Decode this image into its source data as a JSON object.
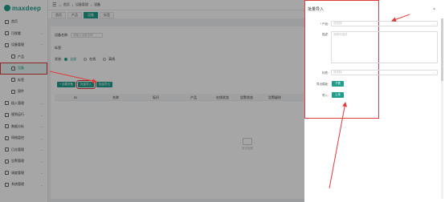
{
  "brand": {
    "name": "maxdeep"
  },
  "header": {
    "breadcrumb": [
      "首页",
      "设备管理",
      "设备"
    ]
  },
  "tabs": [
    {
      "label": "首页",
      "active": false
    },
    {
      "label": "产品",
      "active": false
    },
    {
      "label": "设备",
      "active": true
    },
    {
      "label": "标签",
      "active": false
    }
  ],
  "sidebar": {
    "items": [
      {
        "label": "首页",
        "sub": false,
        "active": false
      },
      {
        "label": "可视看",
        "sub": false,
        "active": false,
        "chev": "⌄"
      },
      {
        "label": "设备管理",
        "sub": false,
        "active": false,
        "chev": "⌃"
      },
      {
        "label": "产品",
        "sub": true,
        "active": false
      },
      {
        "label": "设备",
        "sub": true,
        "active": true
      },
      {
        "label": "标签",
        "sub": true,
        "active": false
      },
      {
        "label": "固件",
        "sub": true,
        "active": false
      },
      {
        "label": "插入管理",
        "sub": false,
        "active": false,
        "chev": "⌄"
      },
      {
        "label": "规则运行",
        "sub": false,
        "active": false,
        "chev": "⌄"
      },
      {
        "label": "数据分析",
        "sub": false,
        "active": false,
        "chev": "⌄"
      },
      {
        "label": "网络监控",
        "sub": false,
        "active": false,
        "chev": "⌄"
      },
      {
        "label": "日志管理",
        "sub": false,
        "active": false,
        "chev": "⌄"
      },
      {
        "label": "告警管理",
        "sub": false,
        "active": false,
        "chev": "⌄"
      },
      {
        "label": "调度管理",
        "sub": false,
        "active": false,
        "chev": "⌄"
      },
      {
        "label": "系统管理",
        "sub": false,
        "active": false,
        "chev": "⌄"
      }
    ]
  },
  "filter": {
    "name_label": "设备名称:",
    "name_placeholder": "请输入设备名称",
    "tag_label": "标签:",
    "status_label": "状态:",
    "status_options": [
      "全部",
      "在线",
      "离线"
    ],
    "status_selected": 0
  },
  "toolbar": {
    "buttons": [
      "+ 创建设备",
      "批量导入",
      "批量导出"
    ]
  },
  "table": {
    "columns": [
      "ID",
      "名称",
      "标识",
      "产品",
      "在线状态",
      "告警状态",
      "告警级别"
    ]
  },
  "empty": {
    "text": "暂无数据"
  },
  "dialog": {
    "title": "批量导入",
    "close": "×",
    "product_label": "* 产品:",
    "product_placeholder": "请选择",
    "desc_label": "描述:",
    "desc_placeholder": "请填写描述",
    "type_label": "标签:",
    "type_placeholder": "请选择",
    "template_label": "导出模板:",
    "template_button": "下载",
    "import_label": "导入:",
    "import_button": "上传"
  },
  "colors": {
    "accent": "#1f9e8c",
    "annotation": "#e03a3a"
  }
}
